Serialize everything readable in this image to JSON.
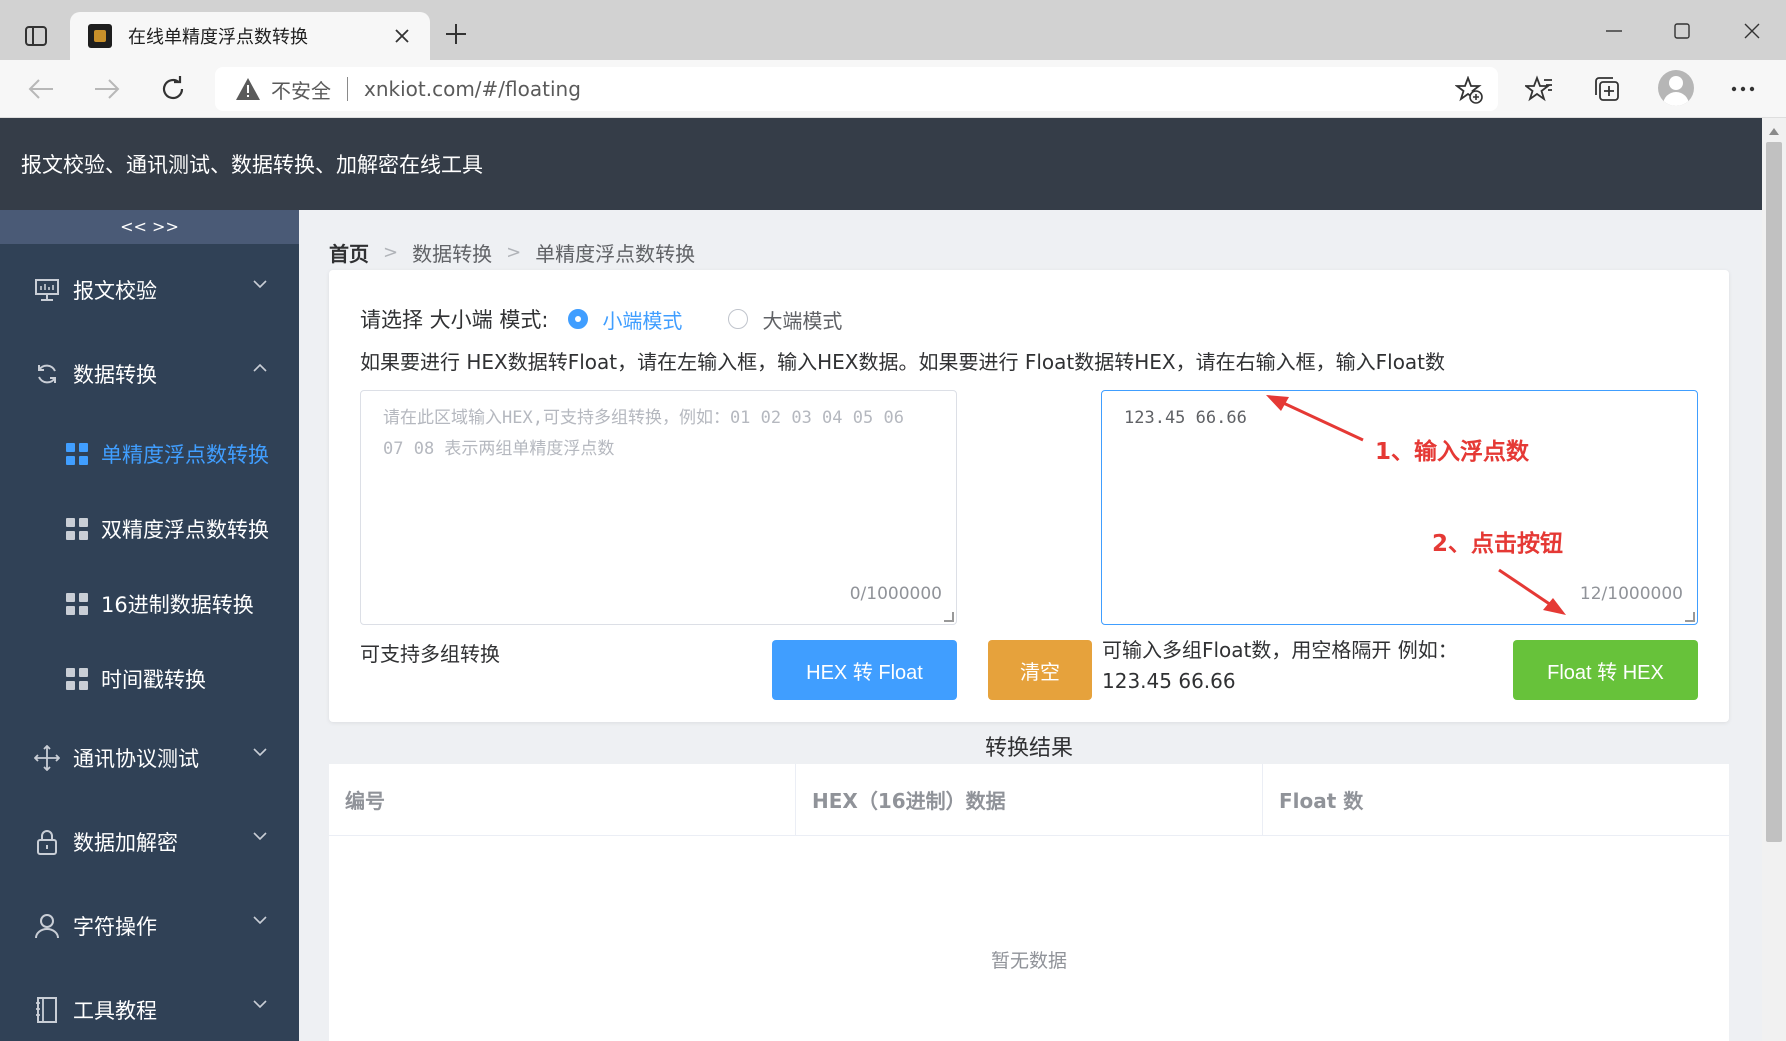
{
  "browser": {
    "tab_title": "在线单精度浮点数转换",
    "insecure_label": "不安全",
    "url": "xnkiot.com/#/floating"
  },
  "header": {
    "title": "报文校验、通讯测试、数据转换、加解密在线工具"
  },
  "sidebar": {
    "collapse_label": "<< >>",
    "items": [
      {
        "label": "报文校验",
        "icon": "monitor-icon",
        "expanded": false
      },
      {
        "label": "数据转换",
        "icon": "refresh-icon",
        "expanded": true
      },
      {
        "label": "通讯协议测试",
        "icon": "move-icon",
        "expanded": false
      },
      {
        "label": "数据加解密",
        "icon": "lock-icon",
        "expanded": false
      },
      {
        "label": "字符操作",
        "icon": "user-icon",
        "expanded": false
      },
      {
        "label": "工具教程",
        "icon": "book-icon",
        "expanded": false
      }
    ],
    "sub_items": [
      {
        "label": "单精度浮点数转换",
        "active": true
      },
      {
        "label": "双精度浮点数转换",
        "active": false
      },
      {
        "label": "16进制数据转换",
        "active": false
      },
      {
        "label": "时间戳转换",
        "active": false
      }
    ]
  },
  "breadcrumb": {
    "home": "首页",
    "level1": "数据转换",
    "level2": "单精度浮点数转换"
  },
  "converter": {
    "mode_label": "请选择 大小端 模式:",
    "mode_little": "小端模式",
    "mode_big": "大端模式",
    "selected_mode": "little",
    "instruction": "如果要进行 HEX数据转Float，请在左输入框，输入HEX数据。如果要进行 Float数据转HEX，请在右输入框，输入Float数",
    "hex_input": {
      "value": "",
      "placeholder": "请在此区域输入HEX,可支持多组转换，例如：01 02 03 04 05 06 07 08 表示两组单精度浮点数",
      "counter": "0/1000000"
    },
    "float_input": {
      "value": "123.45 66.66",
      "placeholder": "",
      "counter": "12/1000000"
    },
    "left_note": "可支持多组转换",
    "hex_to_float_button": "HEX 转 Float",
    "clear_button": "清空",
    "right_note": "可输入多组Float数，用空格隔开 例如：123.45 66.66",
    "float_to_hex_button": "Float 转 HEX",
    "annotation_1": "1、输入浮点数",
    "annotation_2": "2、点击按钮",
    "annotation_color": "#e53935"
  },
  "result": {
    "title": "转换结果",
    "columns": [
      "编号",
      "HEX（16进制）数据",
      "Float 数"
    ],
    "empty_text": "暂无数据"
  },
  "colors": {
    "primary": "#409eff",
    "success": "#67c23a",
    "warning": "#e6a23c",
    "sidebar_bg": "#304156",
    "header_bg": "#353d48"
  }
}
